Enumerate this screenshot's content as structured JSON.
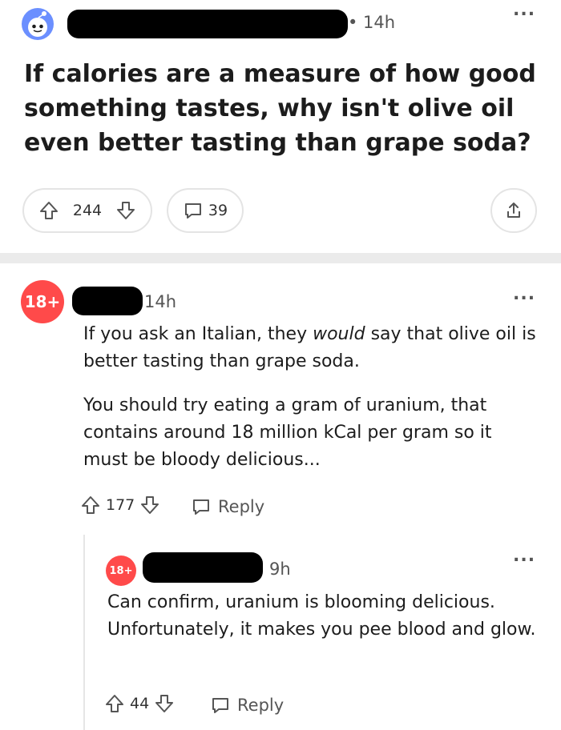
{
  "post": {
    "time": "• 14h",
    "more": "...",
    "title": "If calories are a measure of how good something tastes, why isn't olive oil even better tasting than grape soda?",
    "upvotes": "244",
    "comments": "39"
  },
  "comments": [
    {
      "badge": "18+",
      "time": "14h",
      "more": "...",
      "p1_a": "If you ask an Italian, they ",
      "p1_em": "would",
      "p1_b": " say that olive oil is better tasting than grape soda.",
      "p2": "You should try eating a gram of uranium, that contains around 18 million kCal per gram so it must be bloody delicious...",
      "votes": "177",
      "reply_label": "Reply"
    },
    {
      "badge": "18+",
      "time": "9h",
      "more": "...",
      "p1": "Can confirm, uranium is blooming delicious. Unfortunately, it makes you pee blood and glow.",
      "votes": "44",
      "reply_label": "Reply"
    }
  ],
  "colors": {
    "badge": "#ff4a4a",
    "divider": "#ebebeb",
    "avatar": "#6b8fff"
  },
  "icons": [
    "snoo-avatar-icon",
    "upvote-icon",
    "downvote-icon",
    "comment-icon",
    "share-icon",
    "more-icon"
  ]
}
